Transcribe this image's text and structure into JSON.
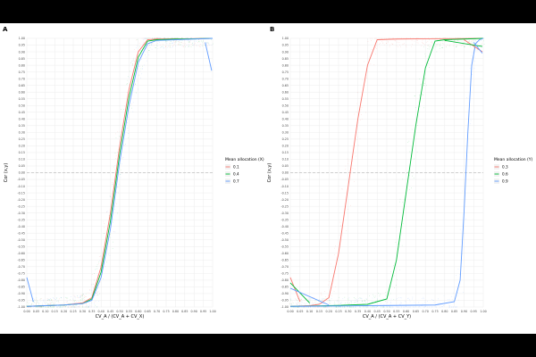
{
  "chart_data": [
    {
      "panel_label": "A",
      "type": "scatter",
      "xlabel": "CV_A / (CV_A + CV_X)",
      "ylabel": "Cor (x,y)",
      "xlim": [
        0,
        1
      ],
      "ylim": [
        -1,
        1
      ],
      "grid": true,
      "reference_line": 0,
      "legend": {
        "title": "Mean allocation (X)",
        "placement": "right",
        "entries": [
          "0.1",
          "0.4",
          "0.7"
        ]
      },
      "series": [
        {
          "name": "0.1",
          "color": "#F8766D",
          "x": [
            0.0,
            0.1,
            0.2,
            0.3,
            0.35,
            0.4,
            0.45,
            0.5,
            0.55,
            0.6,
            0.65,
            0.7,
            0.8,
            0.9,
            1.0
          ],
          "y": [
            -0.995,
            -0.99,
            -0.985,
            -0.97,
            -0.93,
            -0.7,
            -0.3,
            0.2,
            0.62,
            0.9,
            0.99,
            0.995,
            0.997,
            0.998,
            1.0
          ]
        },
        {
          "name": "0.4",
          "color": "#00BA38",
          "x": [
            0.0,
            0.1,
            0.2,
            0.3,
            0.35,
            0.4,
            0.45,
            0.5,
            0.55,
            0.6,
            0.65,
            0.7,
            0.8,
            0.9,
            1.0
          ],
          "y": [
            -0.995,
            -0.99,
            -0.985,
            -0.975,
            -0.94,
            -0.74,
            -0.36,
            0.14,
            0.56,
            0.86,
            0.98,
            0.99,
            0.995,
            0.997,
            1.0
          ]
        },
        {
          "name": "0.7",
          "color": "#619CFF",
          "x": [
            0.0,
            0.1,
            0.2,
            0.3,
            0.35,
            0.4,
            0.45,
            0.5,
            0.55,
            0.6,
            0.65,
            0.7,
            0.8,
            0.9,
            1.0
          ],
          "y": [
            -0.995,
            -0.99,
            -0.985,
            -0.975,
            -0.95,
            -0.78,
            -0.42,
            0.08,
            0.5,
            0.82,
            0.96,
            0.985,
            0.99,
            0.995,
            1.0
          ]
        }
      ],
      "tails": [
        {
          "color": "#619CFF",
          "x": [
            0.0,
            0.035
          ],
          "y": [
            -0.78,
            -0.96
          ]
        },
        {
          "color": "#619CFF",
          "x": [
            0.96,
            0.995
          ],
          "y": [
            0.97,
            0.76
          ]
        }
      ]
    },
    {
      "panel_label": "B",
      "type": "scatter",
      "xlabel": "CV_A / (CV_A + CV_Y)",
      "ylabel": "Cor (x,y)",
      "xlim": [
        0,
        1
      ],
      "ylim": [
        -1,
        1
      ],
      "grid": true,
      "reference_line": 0,
      "legend": {
        "title": "Mean allocation (Y)",
        "placement": "right",
        "entries": [
          "0.3",
          "0.6",
          "0.9"
        ]
      },
      "series": [
        {
          "name": "0.3",
          "color": "#F8766D",
          "x": [
            0.0,
            0.1,
            0.15,
            0.2,
            0.25,
            0.3,
            0.35,
            0.4,
            0.45,
            0.55,
            0.7,
            0.85,
            1.0
          ],
          "y": [
            -0.995,
            -0.99,
            -0.98,
            -0.93,
            -0.6,
            -0.1,
            0.4,
            0.8,
            0.99,
            0.995,
            0.997,
            0.998,
            1.0
          ]
        },
        {
          "name": "0.6",
          "color": "#00BA38",
          "x": [
            0.0,
            0.2,
            0.4,
            0.5,
            0.55,
            0.6,
            0.65,
            0.7,
            0.75,
            0.8,
            0.9,
            1.0
          ],
          "y": [
            -0.995,
            -0.99,
            -0.98,
            -0.94,
            -0.65,
            -0.15,
            0.35,
            0.78,
            0.98,
            0.99,
            0.995,
            1.0
          ]
        },
        {
          "name": "0.9",
          "color": "#619CFF",
          "x": [
            0.0,
            0.4,
            0.75,
            0.85,
            0.88,
            0.9,
            0.92,
            0.94,
            0.96,
            0.98,
            1.0
          ],
          "y": [
            -0.995,
            -0.99,
            -0.985,
            -0.96,
            -0.8,
            -0.3,
            0.3,
            0.8,
            0.96,
            0.99,
            1.0
          ]
        }
      ],
      "tails": [
        {
          "color": "#F8766D",
          "x": [
            0.0,
            0.05
          ],
          "y": [
            -0.78,
            -0.96
          ]
        },
        {
          "color": "#00BA38",
          "x": [
            0.0,
            0.1
          ],
          "y": [
            -0.82,
            -0.97
          ]
        },
        {
          "color": "#619CFF",
          "x": [
            0.0,
            0.2
          ],
          "y": [
            -0.86,
            -0.985
          ]
        },
        {
          "color": "#F8766D",
          "x": [
            0.9,
            0.995
          ],
          "y": [
            0.99,
            0.9
          ]
        },
        {
          "color": "#00BA38",
          "x": [
            0.8,
            0.995
          ],
          "y": [
            0.985,
            0.94
          ]
        },
        {
          "color": "#619CFF",
          "x": [
            0.95,
            0.995
          ],
          "y": [
            0.97,
            0.89
          ]
        }
      ]
    }
  ]
}
